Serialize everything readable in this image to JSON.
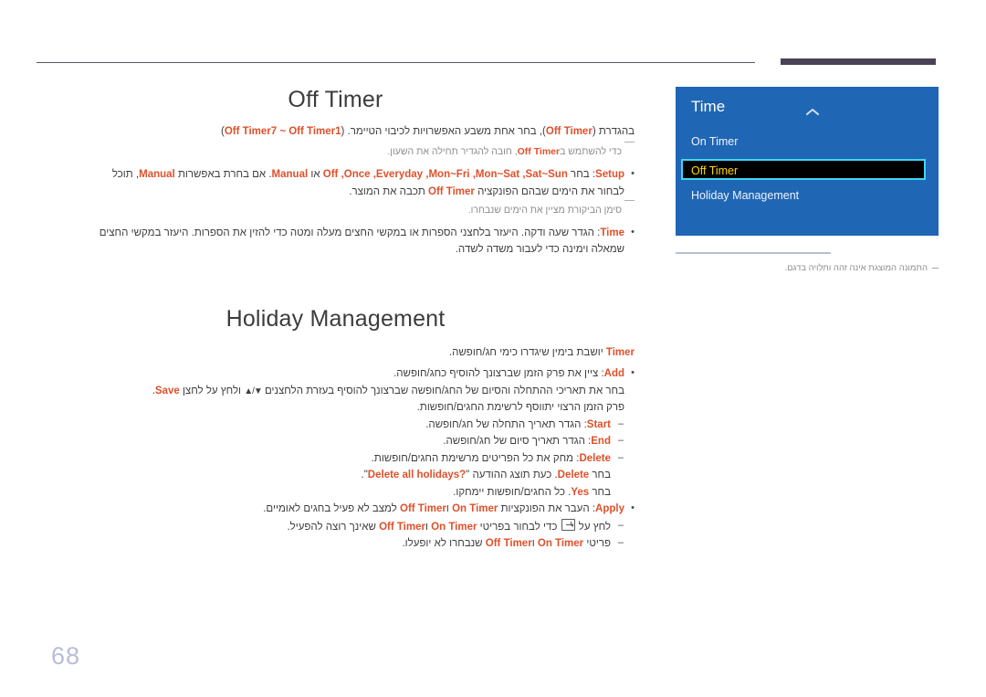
{
  "page": {
    "number": "68",
    "language": "he",
    "accent_color": "#e0502a",
    "rule_color": "#4a4355"
  },
  "sections": [
    {
      "title": "Off Timer",
      "lead": {
        "pre": "בהגדרת (",
        "kw1": "Off Timer",
        "mid": "), בחר אחת משבע האפשרויות לכיבוי הטיימר. (",
        "kw2": "Off Timer7 ~ Off Timer1",
        "post": ")"
      },
      "note1": {
        "pre": "כדי להשתמש ב",
        "kw": "Off Timer",
        "post": ", חובה להגדיר תחילה את השעון."
      },
      "bullets": [
        {
          "label": "Setup",
          "line1_a": ": בחר ",
          "line1_kw": "Off ,Once ,Everyday ,Mon~Fri ,Mon~Sat ,Sat~Sun",
          "line1_b": " או ",
          "line1_kw2": "Manual",
          "line1_c": ". אם בחרת באפשרות ",
          "line1_kw3": "Manual",
          "line1_d": ", תוכל",
          "line2_a": "לבחור את הימים שבהם הפונקציה ",
          "line2_kw": "Off Timer",
          "line2_b": " תכבה את המוצר."
        }
      ],
      "note2": "סימן הביקורת מציין את הימים שנבחרו.",
      "bullets2": [
        {
          "label": "Time",
          "line1": ": הגדר שעה ודקה. היעזר בלחצני הספרות או במקשי החצים מעלה ומטה כדי להזין את הספרות. היעזר במקשי החצים",
          "line2": "שמאלה וימינה כדי לעבור משדה לשדה."
        }
      ]
    },
    {
      "title": "Holiday Management",
      "lead": {
        "kw": "Timer",
        "text": " יושבת בימין שיגדרו כימי חג/חופשה."
      },
      "items": [
        {
          "type": "bullet",
          "label": "Add",
          "text": ": ציין את פרק הזמן שברצונך להוסיף כחג/חופשה."
        },
        {
          "type": "cont",
          "pre": "בחר את תאריכי ההתחלה והסיום של החג/חופשה שברצונך להוסיף בעזרת הלחצנים ",
          "arrows": "▲/▼",
          "mid": " ולחץ על לחצן ",
          "kw": "Save",
          "post": "."
        },
        {
          "type": "cont",
          "text": "פרק הזמן הרצוי יתווסף לרשימת החגים/חופשות."
        },
        {
          "type": "sub",
          "label": "Start",
          "text": ": הגדר תאריך התחלה של חג/חופשה."
        },
        {
          "type": "sub",
          "label": "End",
          "text": ": הגדר תאריך סיום של חג/חופשה."
        },
        {
          "type": "sub",
          "label": "Delete",
          "text": ": מחק את כל הפריטים מרשימת החגים/חופשות."
        },
        {
          "type": "cont-sub",
          "pre": "בחר ",
          "kw": "Delete",
          "mid": ". כעת תוצג ההודעה \"",
          "kw2": "Delete all holidays?",
          "post": "\"."
        },
        {
          "type": "cont-sub",
          "pre": "בחר ",
          "kw": "Yes",
          "post": ". כל החגים/חופשות יימחקו."
        },
        {
          "type": "bullet",
          "label": "Apply",
          "pre": ": העבר את הפונקציות ",
          "kw": "On Timer",
          "mid": " ו",
          "kw2": "Off Timer",
          "post": " למצב לא פעיל בחגים לאומיים."
        },
        {
          "type": "sub-enter",
          "pre": "לחץ על ",
          "icon": "enter-key-icon",
          "mid": " כדי לבחור בפריטי ",
          "kw": "On Timer",
          "mid2": " ו",
          "kw2": "Off Timer",
          "post": " שאינך רוצה להפעיל."
        },
        {
          "type": "sub",
          "plain_pre": "פריטי ",
          "kw": "On Timer",
          "plain_mid": " ו",
          "kw2": "Off Timer",
          "plain_post": " שנבחרו לא יופעלו."
        }
      ]
    }
  ],
  "osd": {
    "title": "Time",
    "chevron_icon": "chevron-up-icon",
    "items": [
      {
        "label": "On Timer",
        "selected": false
      },
      {
        "label": "Off Timer",
        "selected": true
      },
      {
        "label": "Holiday Management",
        "selected": false
      }
    ],
    "panel_color": "#1f66b4",
    "selected_bg": "#000000",
    "selected_text_color": "#ffd800",
    "selected_border_color": "#3fd5f5"
  },
  "side_caption": "התמונה המוצגת אינה זהה ותלויה בדגם."
}
